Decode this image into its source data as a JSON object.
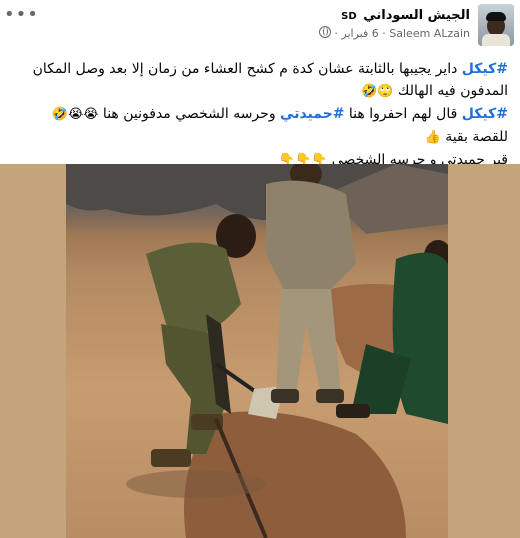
{
  "header": {
    "page_name": "الجيش السوداني",
    "page_tag": "SD",
    "author": "Saleem ALzain",
    "date": "6 فبراير",
    "separator": "·",
    "more_label": "•••",
    "audience_icon": "globe-icon"
  },
  "post": {
    "line1_hashtag": "#كيكل",
    "line1_text": " داير يجيبها بالثابتة عشان كدة م كشح العشاء من زمان إلا بعد وصل المكان المدفون فيه الهالك ",
    "line1_emoji": "🙄🤣",
    "line2_hashtag": "#كيكل",
    "line2_text_a": " قال لهم احفروا هنا ",
    "line2_hashtag2": "#حميدتي",
    "line2_text_b": " وحرسه الشخصي مدفونين هنا ",
    "line2_emoji": "😭😭🤣",
    "line3_text": "للقصة بقية ",
    "line3_emoji": "👍",
    "line4_text": "قبر حميدتي و حرسه الشخصي ",
    "line4_emoji": "👇👇👇"
  },
  "photo": {
    "subject": "soldiers-digging-photo",
    "colors": {
      "frame": "#c4a57b",
      "soil": "#b48a62",
      "camo": "#5b5f37",
      "green_uniform": "#1f4a2e"
    }
  }
}
